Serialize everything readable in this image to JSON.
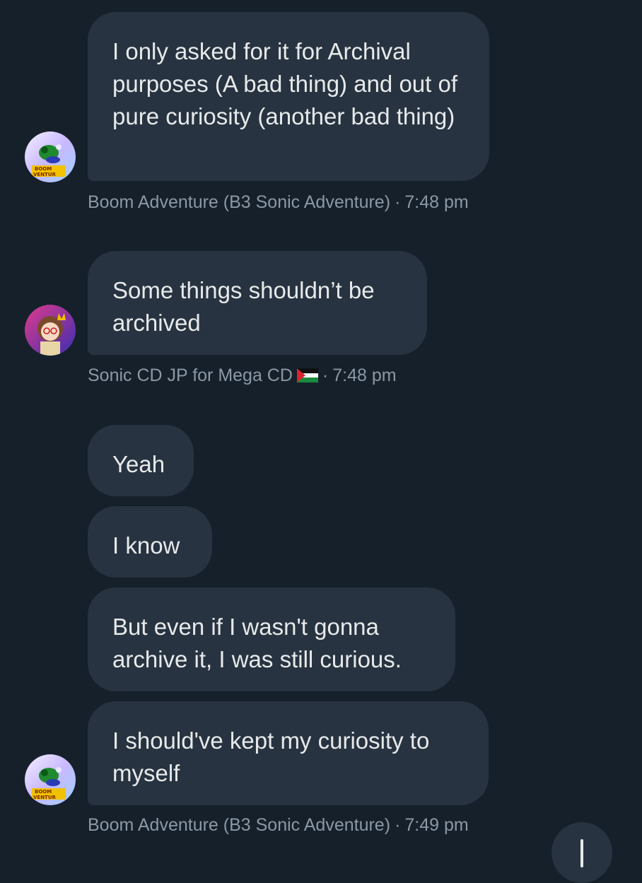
{
  "messages": [
    {
      "text": "I only asked for it for Archival purposes (A bad thing) and out of pure curiosity (another bad thing)"
    },
    {
      "text": "Some things shouldn’t be archived"
    },
    {
      "text": "Yeah"
    },
    {
      "text": "I know"
    },
    {
      "text": "But even if I wasn't gonna archive it, I was still curious."
    },
    {
      "text": "I should've kept my curiosity to myself"
    }
  ],
  "meta": [
    {
      "sender": "Boom Adventure (B3 Sonic Adventure)",
      "separator": "·",
      "time": "7:48 pm"
    },
    {
      "sender": "Sonic CD JP for Mega CD",
      "flag": "palestine-flag",
      "separator": "·",
      "time": "7:48 pm"
    },
    {
      "sender": "Boom Adventure (B3 Sonic Adventure)",
      "separator": "·",
      "time": "7:49 pm"
    }
  ],
  "avatars": [
    {
      "name": "boom-adventure-avatar",
      "logo_text": [
        "BOOM",
        "VENTUR"
      ]
    },
    {
      "name": "sonic-cd-avatar"
    },
    {
      "name": "boom-adventure-avatar",
      "logo_text": [
        "BOOM",
        "VENTUR"
      ]
    }
  ],
  "fab": {
    "icon": "arrow-down-icon"
  },
  "colors": {
    "background": "#15202b",
    "bubble": "#273340",
    "text": "#e7e9ea",
    "meta_text": "#8b98a5"
  }
}
